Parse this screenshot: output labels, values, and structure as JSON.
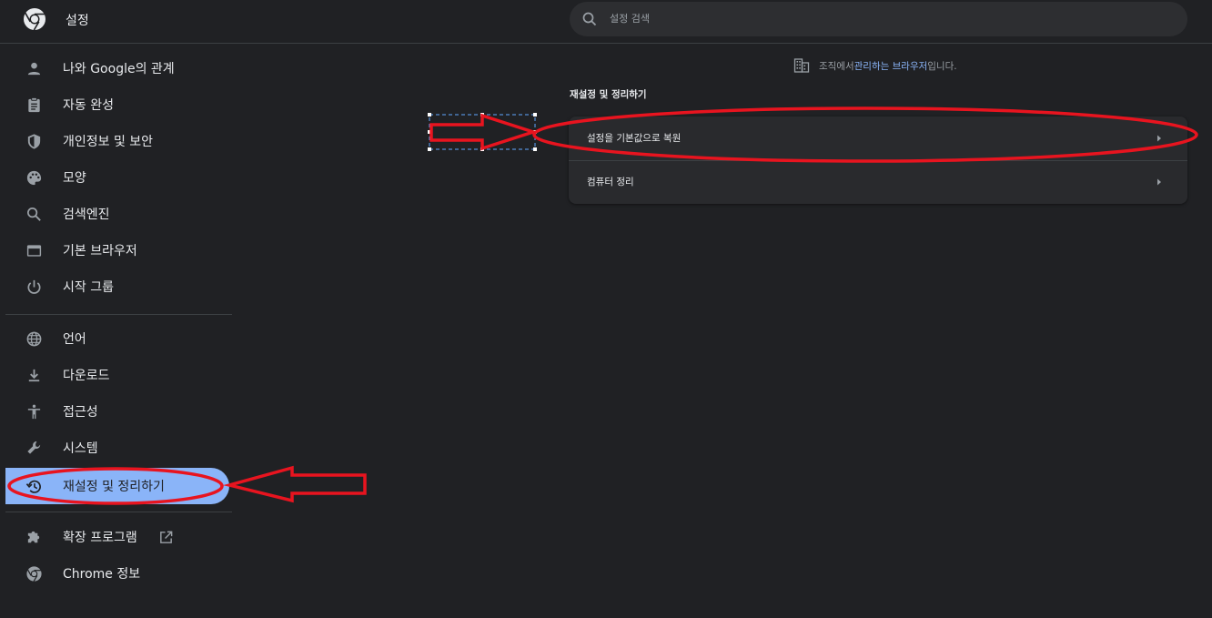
{
  "header": {
    "title": "설정",
    "search_placeholder": "설정 검색"
  },
  "sidebar": {
    "items": [
      {
        "label": "나와 Google의 관계",
        "icon": "person-icon"
      },
      {
        "label": "자동 완성",
        "icon": "clipboard-icon"
      },
      {
        "label": "개인정보 및 보안",
        "icon": "shield-icon"
      },
      {
        "label": "모양",
        "icon": "palette-icon"
      },
      {
        "label": "검색엔진",
        "icon": "search-icon"
      },
      {
        "label": "기본 브라우저",
        "icon": "browser-window-icon"
      },
      {
        "label": "시작 그룹",
        "icon": "power-icon"
      },
      {
        "label": "언어",
        "icon": "globe-icon"
      },
      {
        "label": "다운로드",
        "icon": "download-icon"
      },
      {
        "label": "접근성",
        "icon": "accessibility-icon"
      },
      {
        "label": "시스템",
        "icon": "wrench-icon"
      },
      {
        "label": "재설정 및 정리하기",
        "icon": "restore-icon",
        "selected": true
      },
      {
        "label": "확장 프로그램",
        "icon": "puzzle-icon"
      },
      {
        "label": "Chrome 정보",
        "icon": "chrome-icon"
      }
    ]
  },
  "main": {
    "managed_notice": {
      "prefix": "조직에서 ",
      "link": "관리하는 브라우저",
      "suffix": "입니다."
    },
    "section_title": "재설정 및 정리하기",
    "rows": [
      {
        "label": "설정을 기본값으로 복원"
      },
      {
        "label": "컴퓨터 정리"
      }
    ]
  },
  "colors": {
    "background": "#202124",
    "accent": "#8ab4f8",
    "annotation": "#e8141f"
  }
}
